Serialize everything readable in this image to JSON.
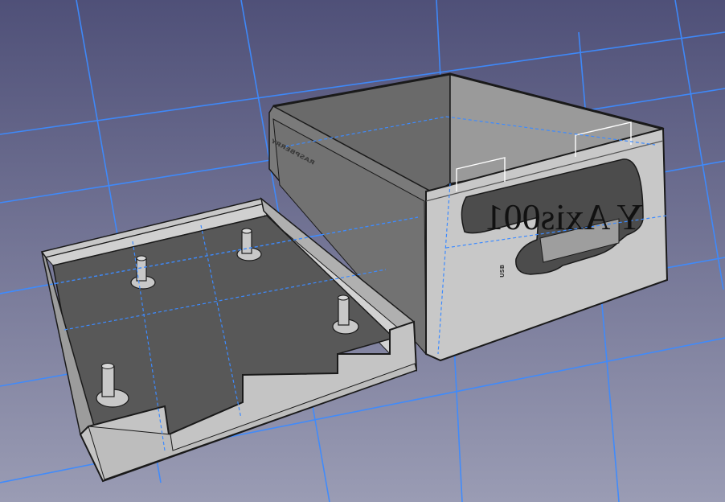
{
  "viewport": {
    "background_top": "#4f5078",
    "background_bottom": "#9a9cb4",
    "grid_color": "#3d8bff"
  },
  "model": {
    "box_face_color": "#c8c8c8",
    "box_edge_color": "#1a1a1a",
    "inner_color": "#5c5c5c",
    "selection_outline_color": "#ffffff"
  },
  "labels": {
    "axis_label": "Y Axis001",
    "side_engraving": "RASPBERRY",
    "front_engraving": "USB"
  }
}
